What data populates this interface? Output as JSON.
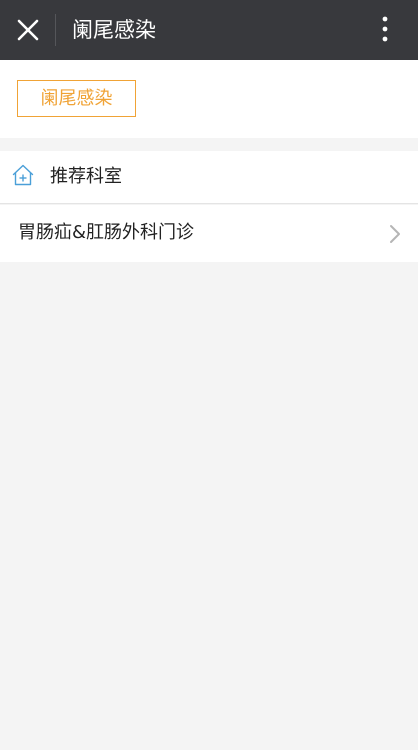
{
  "topbar": {
    "title": "阑尾感染",
    "close_icon": "close-icon",
    "more_icon": "more-vertical-icon",
    "background": "#38393d"
  },
  "tag": {
    "label": "阑尾感染",
    "color": "#f0a336"
  },
  "recommend": {
    "label": "推荐科室",
    "icon": "home-plus-icon",
    "icon_color": "#4a9fd8"
  },
  "departments": [
    {
      "label": "胃肠疝&肛肠外科门诊",
      "icon": "chevron-right-icon"
    }
  ]
}
